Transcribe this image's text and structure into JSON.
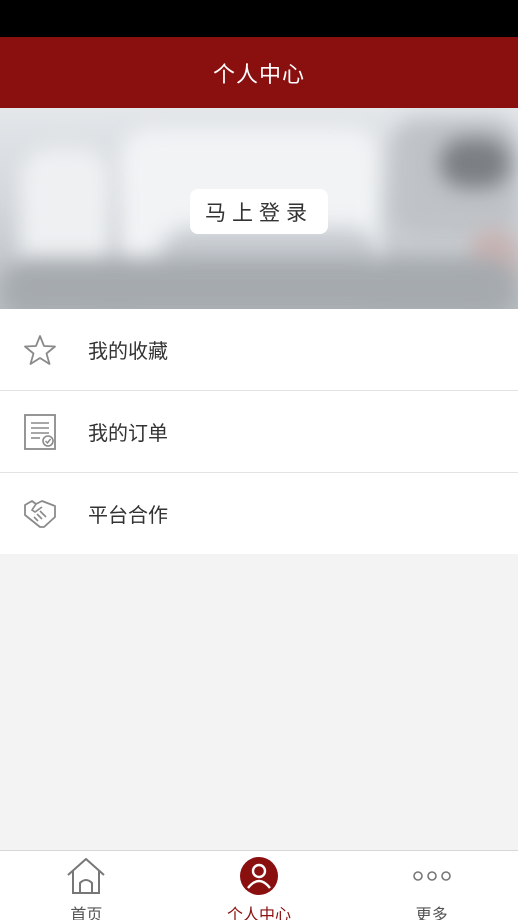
{
  "header": {
    "title": "个人中心"
  },
  "banner": {
    "login_label": "马上登录"
  },
  "menu": {
    "items": [
      {
        "label": "我的收藏",
        "icon": "star-icon"
      },
      {
        "label": "我的订单",
        "icon": "order-list-icon"
      },
      {
        "label": "平台合作",
        "icon": "handshake-icon"
      }
    ]
  },
  "tabbar": {
    "items": [
      {
        "label": "首页",
        "icon": "home-icon",
        "active": false
      },
      {
        "label": "个人中心",
        "icon": "user-icon",
        "active": true
      },
      {
        "label": "更多",
        "icon": "more-dots-icon",
        "active": false
      }
    ]
  },
  "colors": {
    "brand": "#8a0f0f",
    "background": "#f3f3f3"
  }
}
